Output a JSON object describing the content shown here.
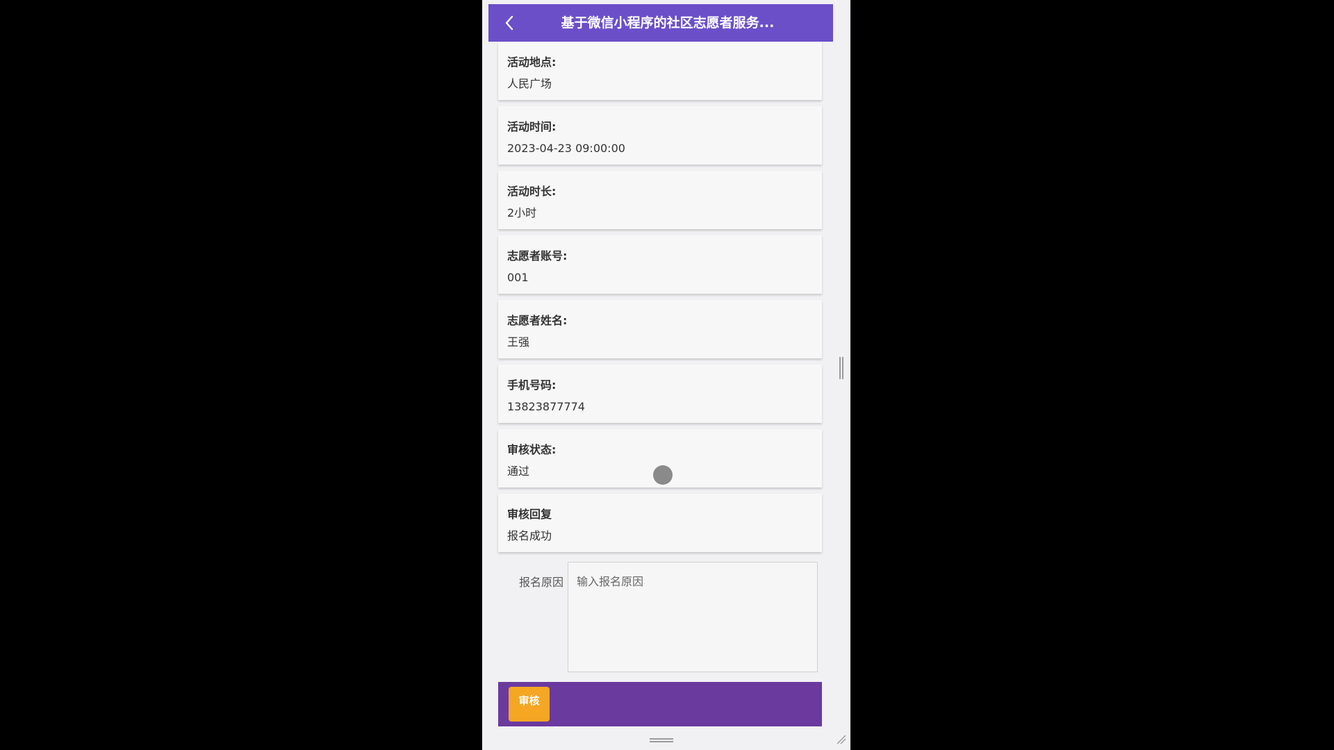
{
  "header": {
    "title": "基于微信小程序的社区志愿者服务..."
  },
  "details": [
    {
      "label": "活动地点:",
      "value": "人民广场"
    },
    {
      "label": "活动时间:",
      "value": "2023-04-23 09:00:00"
    },
    {
      "label": "活动时长:",
      "value": "2小时"
    },
    {
      "label": "志愿者账号:",
      "value": "001"
    },
    {
      "label": "志愿者姓名:",
      "value": "王强"
    },
    {
      "label": "手机号码:",
      "value": "13823877774"
    },
    {
      "label": "审核状态:",
      "value": "通过"
    },
    {
      "label": "审核回复",
      "value": "报名成功"
    }
  ],
  "reason": {
    "label": "报名原因",
    "placeholder": "输入报名原因"
  },
  "actions": {
    "audit_label": "审核"
  },
  "colors": {
    "header_bg": "#6b4fc9",
    "action_bar_bg": "#6a3a9e",
    "audit_button_bg": "#f5a623"
  }
}
